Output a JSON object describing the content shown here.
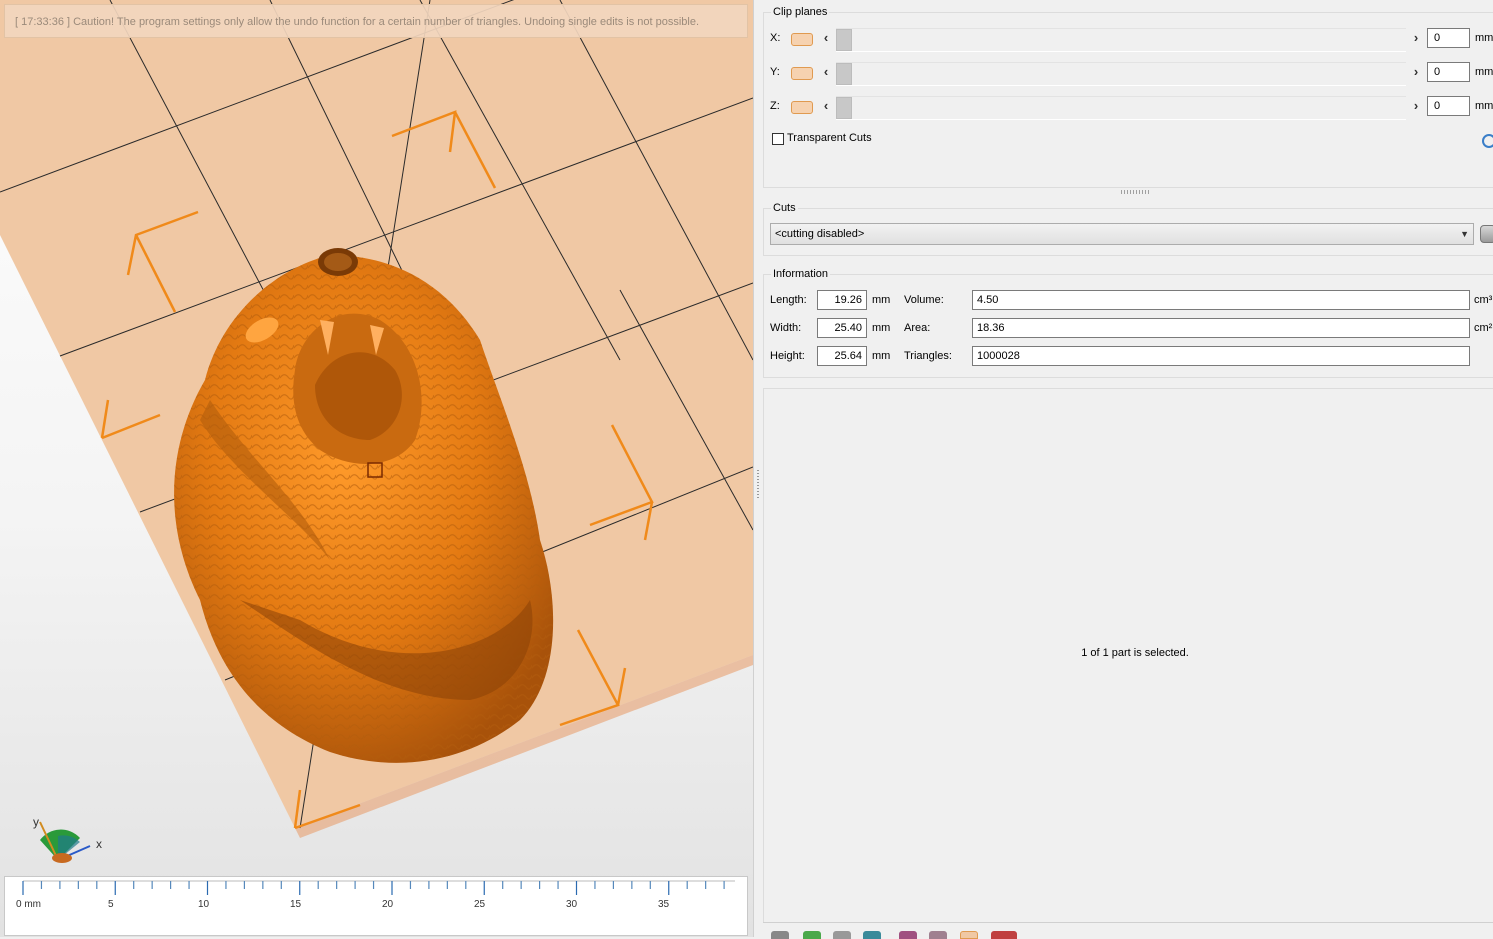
{
  "log": {
    "message": "[ 17:33:36 ] Caution! The program settings only allow the undo function for a certain number of triangles. Undoing single edits is not possible."
  },
  "ruler": {
    "ticks": [
      "0 mm",
      "5",
      "10",
      "15",
      "20",
      "25",
      "30",
      "35"
    ]
  },
  "axis_gizmo": {
    "x_label": "x",
    "y_label": "y"
  },
  "clip_planes": {
    "title": "Clip planes",
    "rows": [
      {
        "label": "X:",
        "value": "0",
        "unit": "mm"
      },
      {
        "label": "Y:",
        "value": "0",
        "unit": "mm"
      },
      {
        "label": "Z:",
        "value": "0",
        "unit": "mm"
      }
    ],
    "transparent_cuts_label": "Transparent Cuts",
    "transparent_cuts_checked": false
  },
  "cuts": {
    "title": "Cuts",
    "selected": "<cutting disabled>"
  },
  "information": {
    "title": "Information",
    "length_label": "Length:",
    "length_value": "19.26",
    "length_unit": "mm",
    "width_label": "Width:",
    "width_value": "25.40",
    "width_unit": "mm",
    "height_label": "Height:",
    "height_value": "25.64",
    "height_unit": "mm",
    "volume_label": "Volume:",
    "volume_value": "4.50",
    "volume_unit": "cm³",
    "area_label": "Area:",
    "area_value": "18.36",
    "area_unit": "cm²",
    "triangles_label": "Triangles:",
    "triangles_value": "1000028"
  },
  "status": {
    "selection_text": "1 of 1 part is selected."
  },
  "colors": {
    "model_orange": "#f08a1a",
    "platform": "#f0c8a4",
    "marker": "#f08a1a",
    "swatch_border": "#e09a50"
  }
}
